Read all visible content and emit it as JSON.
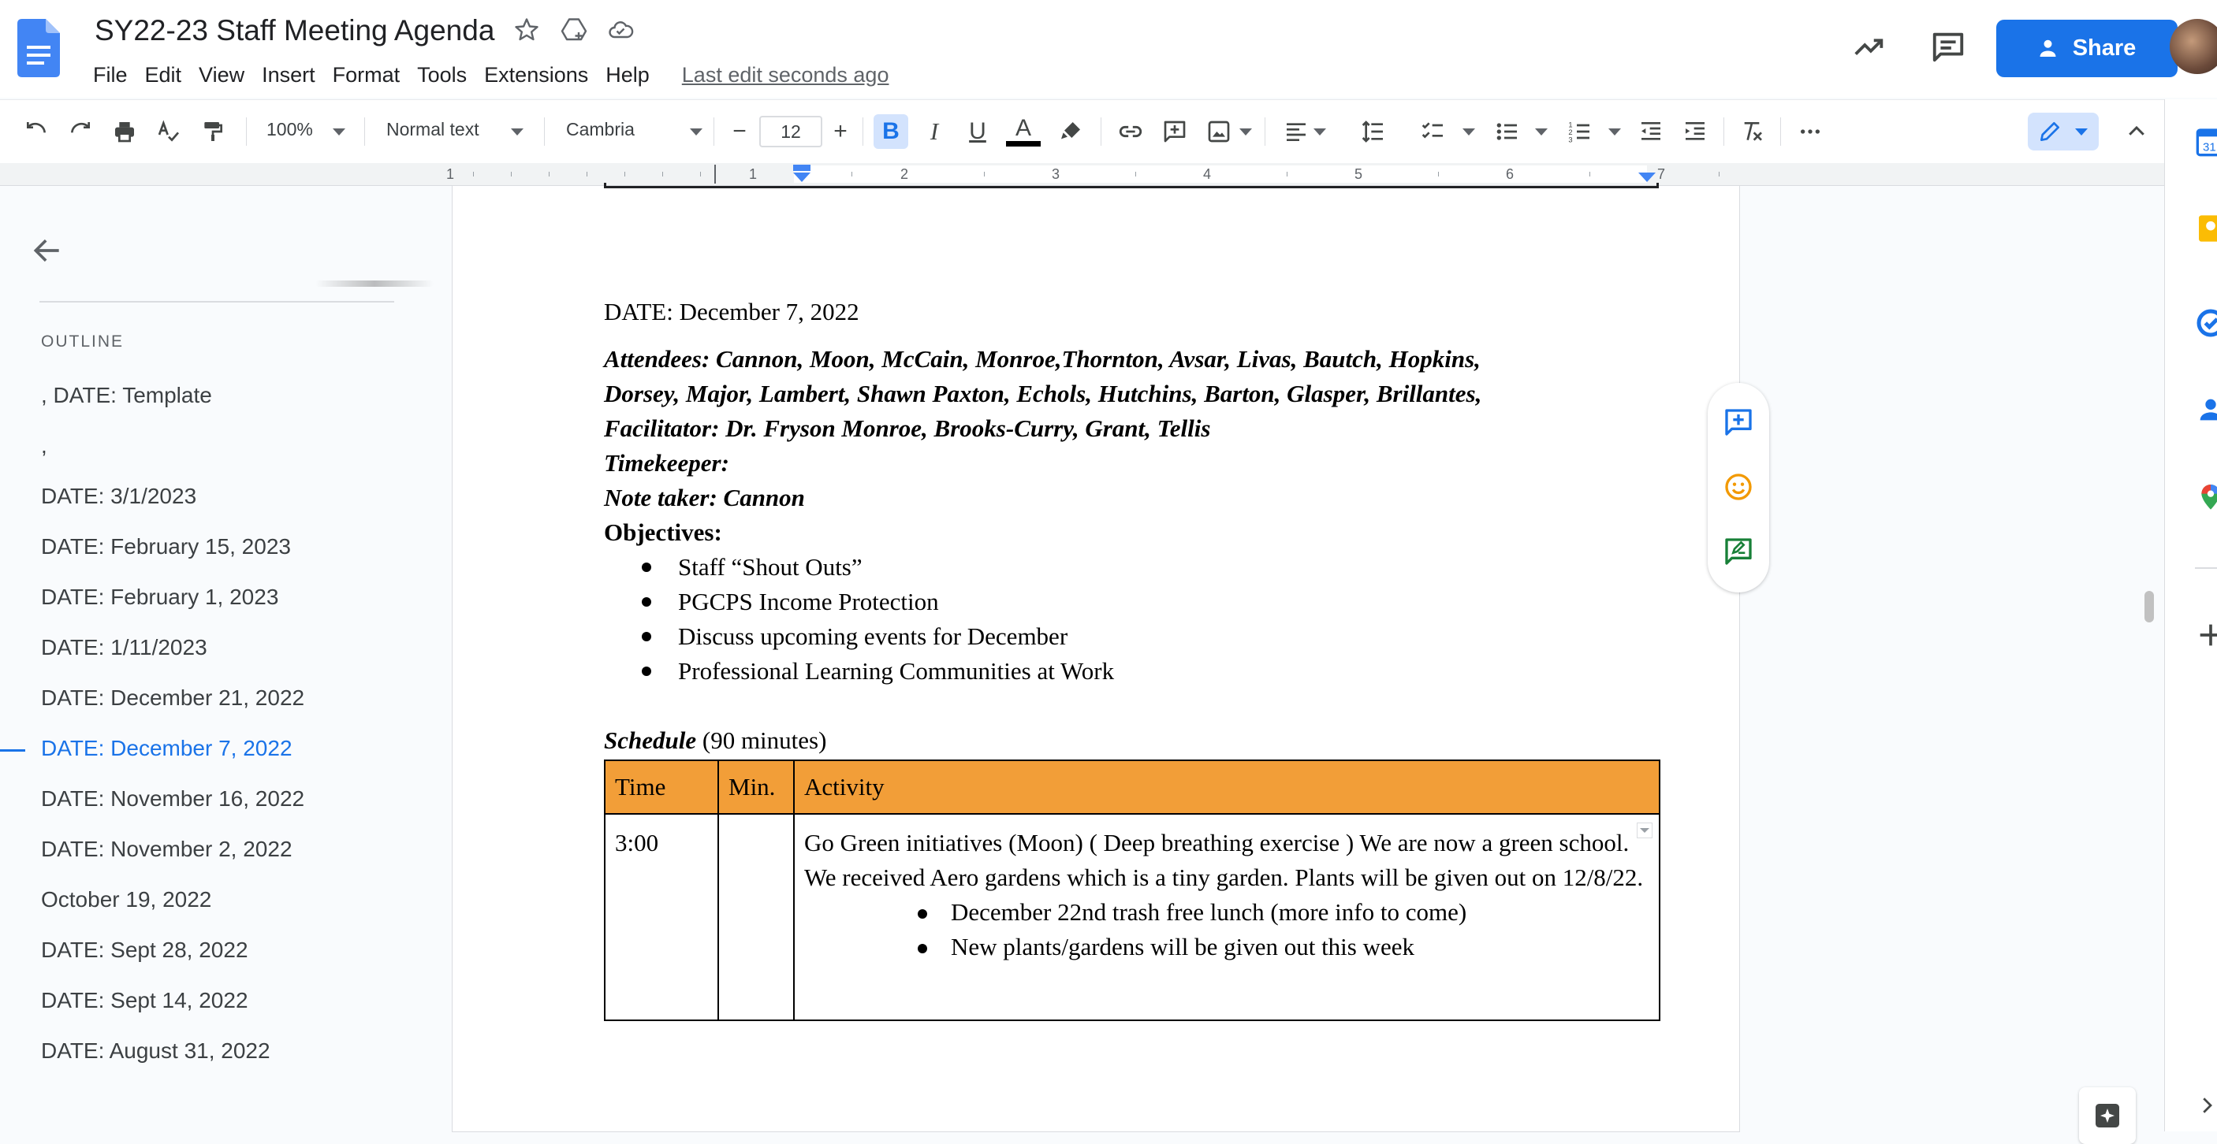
{
  "app": {
    "doc_title": "SY22-23 Staff Meeting Agenda",
    "menu": [
      "File",
      "Edit",
      "View",
      "Insert",
      "Format",
      "Tools",
      "Extensions",
      "Help"
    ],
    "last_edit": "Last edit seconds ago",
    "share_label": "Share",
    "accent_color": "#1a73e8"
  },
  "toolbar": {
    "zoom": "100%",
    "style": "Normal text",
    "font": "Cambria",
    "font_size": "12",
    "minus": "−",
    "plus": "+",
    "bold_glyph": "B",
    "italic_glyph": "I",
    "underline_glyph": "U",
    "text_color_glyph": "A"
  },
  "ruler": {
    "numbers": [
      "1",
      "1",
      "2",
      "3",
      "4",
      "5",
      "6",
      "7"
    ]
  },
  "outline": {
    "heading": "OUTLINE",
    "items": [
      ", DATE: Template",
      ",",
      "DATE: 3/1/2023",
      "DATE: February 15, 2023",
      "DATE: February 1, 2023",
      "DATE: 1/11/2023",
      "DATE: December 21, 2022",
      "DATE: December 7, 2022",
      "DATE: November 16, 2022",
      "DATE: November 2, 2022",
      "October 19, 2022",
      "DATE: Sept 28, 2022",
      "DATE: Sept 14, 2022",
      "DATE: August 31, 2022"
    ],
    "active_index": 7
  },
  "doc": {
    "date_line": "DATE: December 7, 2022",
    "attendees_1": "Attendees:  Cannon, Moon, McCain, Monroe,Thornton, Avsar, Livas, Bautch, Hopkins,",
    "attendees_2": "Dorsey, Major, Lambert, Shawn Paxton, Echols, Hutchins, Barton, Glasper, Brillantes,",
    "facilitator": "Facilitator: Dr. Fryson Monroe, Brooks-Curry, Grant, Tellis",
    "timekeeper": "Timekeeper:",
    "note_taker": "Note taker: Cannon",
    "objectives_label": "Objectives:",
    "objectives": [
      "Staff “Shout Outs”",
      "PGCPS Income Protection",
      "Discuss upcoming events for December",
      "Professional Learning Communities at Work"
    ],
    "schedule_label": "Schedule",
    "schedule_duration": " (90 minutes)",
    "table": {
      "headers": [
        "Time",
        "Min.",
        "Activity"
      ],
      "header_color": "#f29e38",
      "row": {
        "time": "3:00",
        "min": "",
        "activity": "Go Green initiatives (Moon) ( Deep breathing exercise ) We are now a green school. We received Aero gardens which is a tiny garden. Plants will be given out on 12/8/22.",
        "bullets": [
          "December 22nd trash free lunch (more info to come)",
          "New plants/gardens will be given out this week"
        ]
      }
    }
  }
}
